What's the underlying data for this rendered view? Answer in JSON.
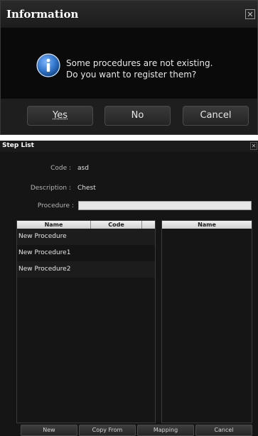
{
  "info_dialog": {
    "title": "Information",
    "close_glyph": "✕",
    "icon": "info-icon",
    "message_line1": "Some procedures are not existing.",
    "message_line2": "Do you want to register them?",
    "buttons": {
      "yes": "Yes",
      "no": "No",
      "cancel": "Cancel"
    }
  },
  "step_list": {
    "title": "Step List",
    "close_glyph": "✕",
    "fields": {
      "code_label": "Code :",
      "code_value": "asd",
      "description_label": "Description :",
      "description_value": "Chest",
      "procedure_label": "Procedure :",
      "procedure_value": ""
    },
    "left_grid": {
      "columns": [
        "Name",
        "Code"
      ],
      "rows": [
        {
          "name": "New Procedure",
          "code": ""
        },
        {
          "name": "New Procedure1",
          "code": ""
        },
        {
          "name": "New Procedure2",
          "code": ""
        }
      ]
    },
    "right_grid": {
      "columns": [
        "Name"
      ]
    },
    "buttons": {
      "new": "New",
      "copy_from": "Copy From",
      "mapping": "Mapping",
      "cancel": "Cancel"
    }
  },
  "colors": {
    "dialog_bg": "#000000",
    "panel_bg": "#151515",
    "header_bg": "#dcdcdc",
    "info_blue": "#2f73c8"
  }
}
